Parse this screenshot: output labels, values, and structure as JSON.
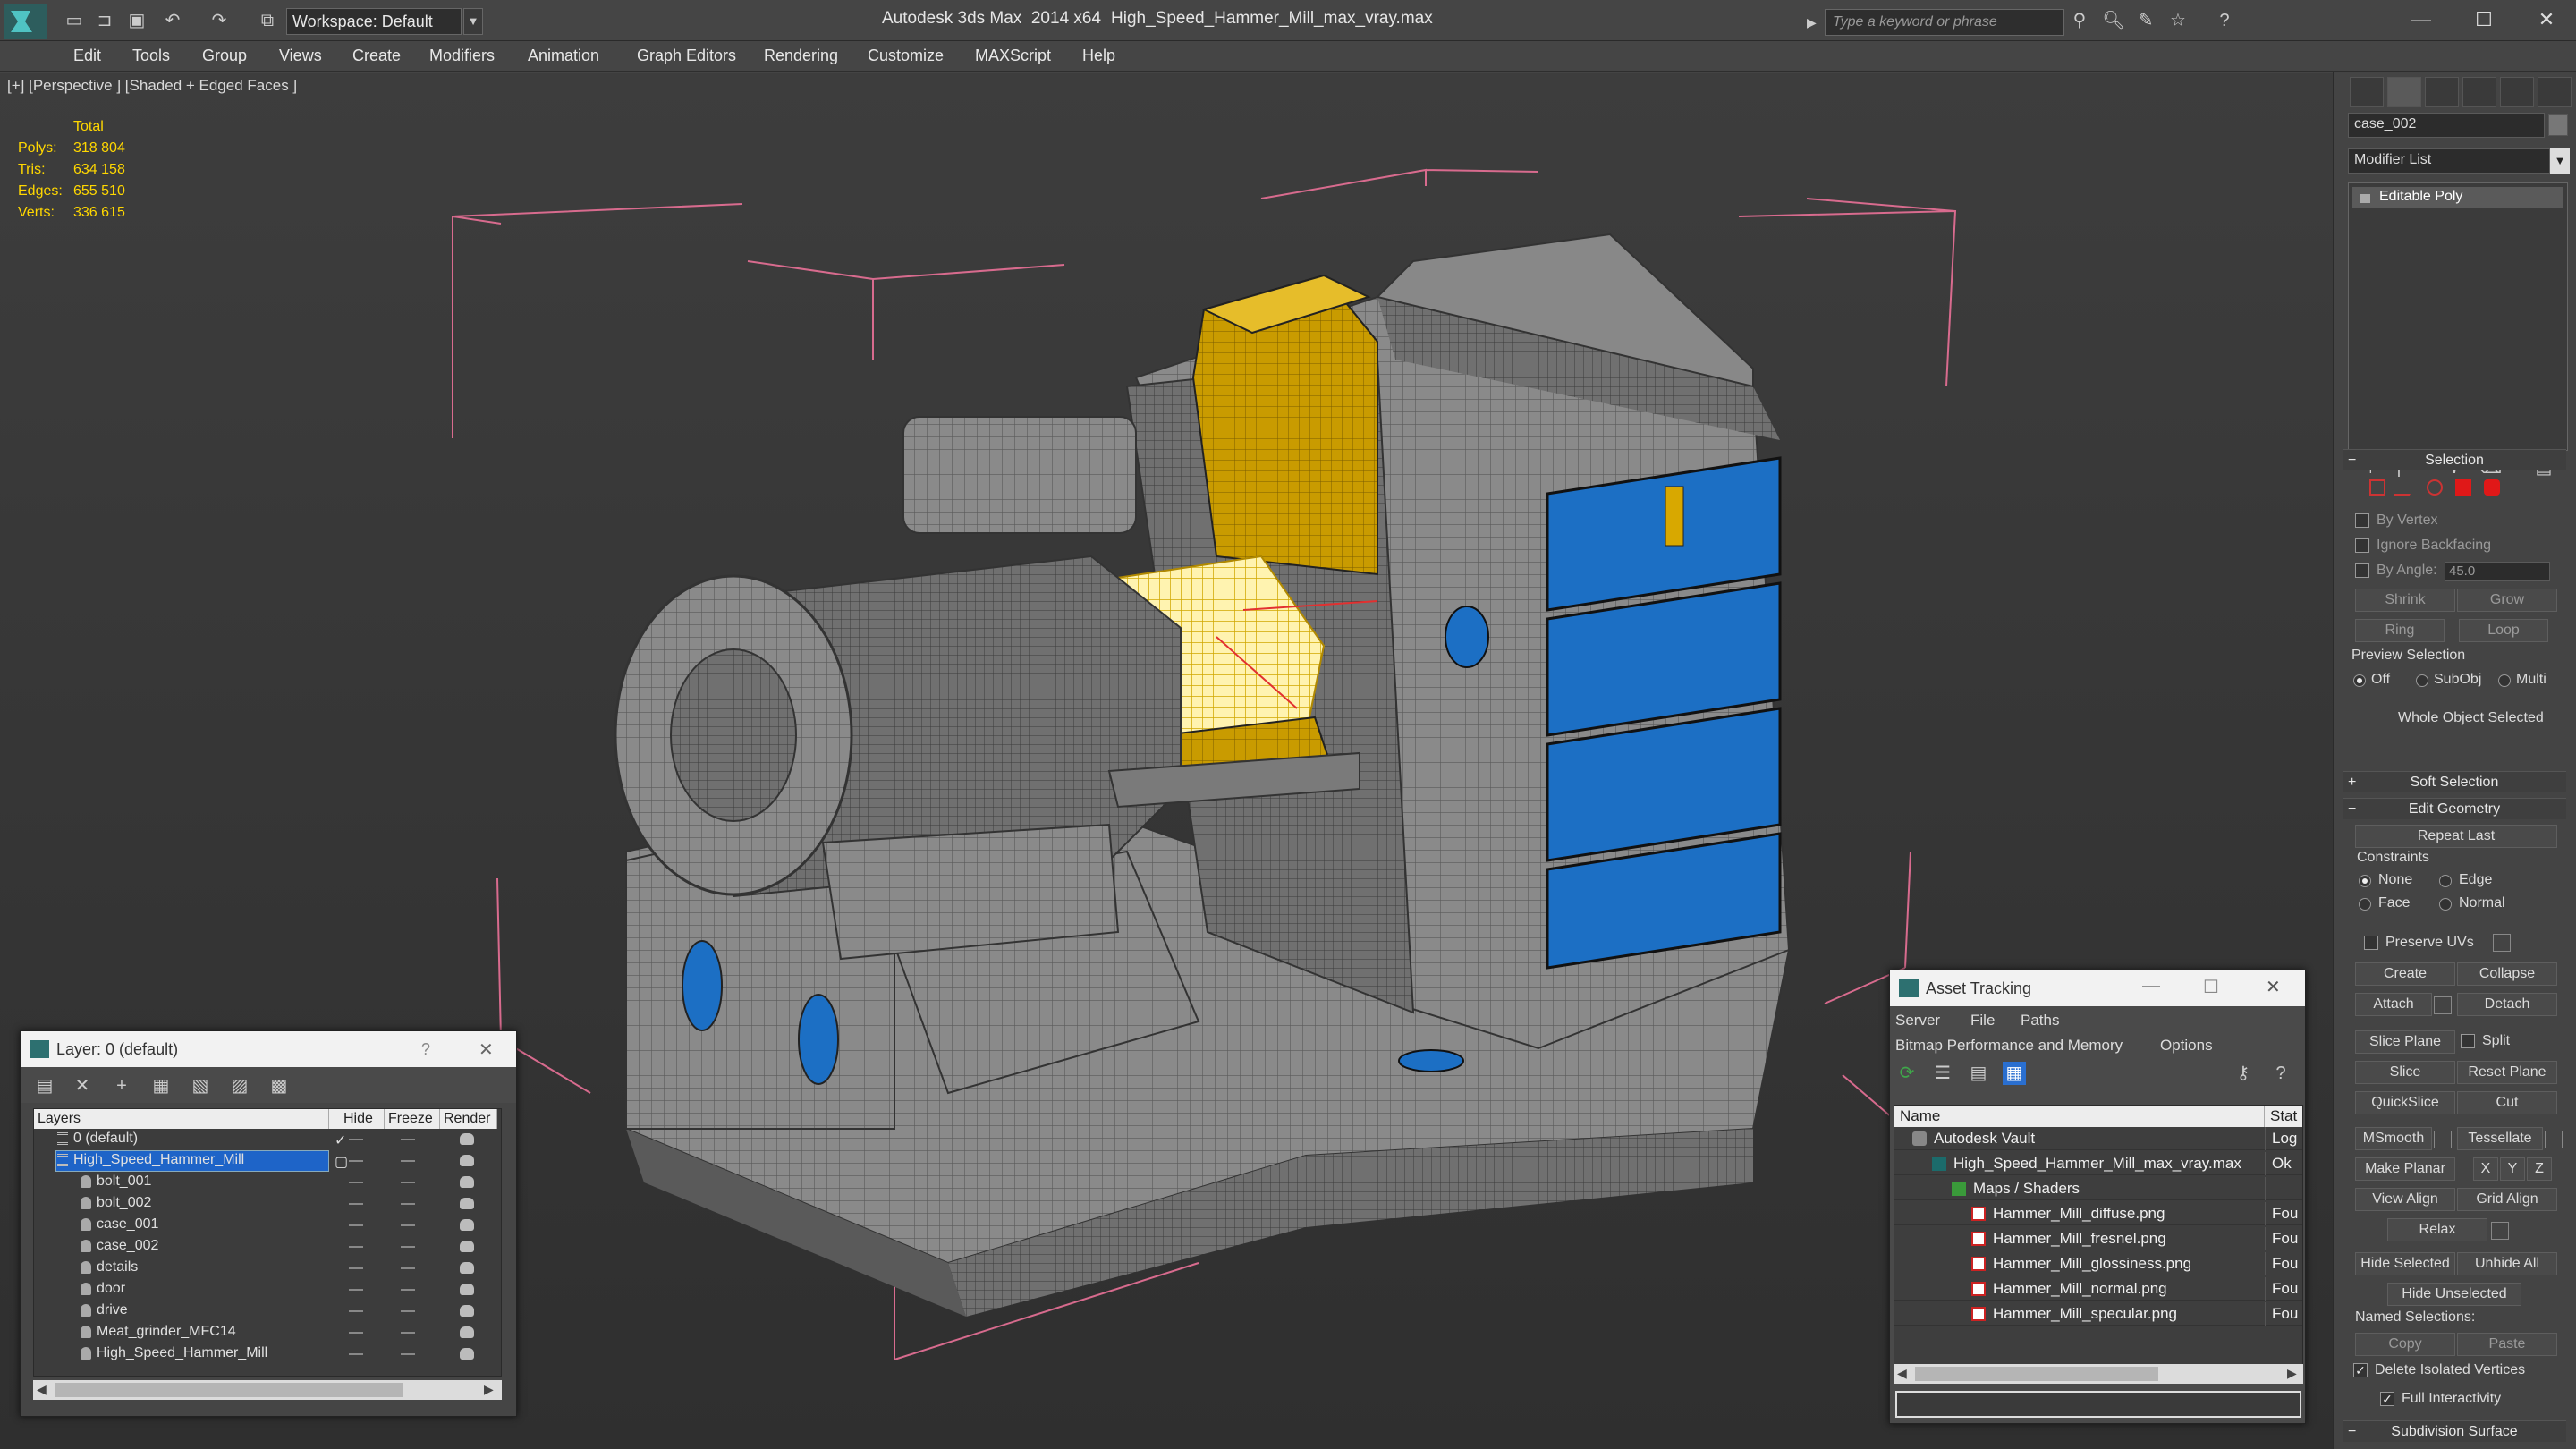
{
  "titlebar": {
    "workspace_label": "Workspace: Default",
    "app_name": "Autodesk 3ds Max  2014 x64",
    "file_name": "High_Speed_Hammer_Mill_max_vray.max",
    "search_placeholder": "Type a keyword or phrase"
  },
  "menu": [
    "Edit",
    "Tools",
    "Group",
    "Views",
    "Create",
    "Modifiers",
    "Animation",
    "Graph Editors",
    "Rendering",
    "Customize",
    "MAXScript",
    "Help"
  ],
  "viewport": {
    "label": "[+] [Perspective ] [Shaded + Edged Faces ]",
    "stats": {
      "header": "Total",
      "rows": [
        {
          "label": "Polys:",
          "value": "318 804"
        },
        {
          "label": "Tris:",
          "value": "634 158"
        },
        {
          "label": "Edges:",
          "value": "655 510"
        },
        {
          "label": "Verts:",
          "value": "336 615"
        }
      ]
    }
  },
  "command_panel": {
    "object_name": "case_002",
    "modifier_list": "Modifier List",
    "stack_item": "Editable Poly",
    "selection": {
      "title": "Selection",
      "by_vertex": "By Vertex",
      "ignore_backfacing": "Ignore Backfacing",
      "by_angle": "By Angle:",
      "angle_value": "45.0",
      "shrink": "Shrink",
      "grow": "Grow",
      "ring": "Ring",
      "loop": "Loop",
      "preview_selection": "Preview Selection",
      "preview_off": "Off",
      "preview_subobj": "SubObj",
      "preview_multi": "Multi",
      "status": "Whole Object Selected"
    },
    "soft_selection": "Soft Selection",
    "edit_geometry": {
      "title": "Edit Geometry",
      "repeat_last": "Repeat Last",
      "constraints": "Constraints",
      "none": "None",
      "edge": "Edge",
      "face": "Face",
      "normal": "Normal",
      "preserve_uvs": "Preserve UVs",
      "create": "Create",
      "collapse": "Collapse",
      "attach": "Attach",
      "detach": "Detach",
      "slice_plane": "Slice Plane",
      "split": "Split",
      "slice": "Slice",
      "reset_plane": "Reset Plane",
      "quickslice": "QuickSlice",
      "cut": "Cut",
      "msmooth": "MSmooth",
      "tessellate": "Tessellate",
      "make_planar": "Make Planar",
      "x": "X",
      "y": "Y",
      "z": "Z",
      "view_align": "View Align",
      "grid_align": "Grid Align",
      "relax": "Relax",
      "hide_selected": "Hide Selected",
      "unhide_all": "Unhide All",
      "hide_unselected": "Hide Unselected",
      "named_selections": "Named Selections:",
      "copy": "Copy",
      "paste": "Paste",
      "delete_isolated": "Delete Isolated Vertices",
      "full_interactivity": "Full Interactivity"
    },
    "subdivision_surface": "Subdivision Surface"
  },
  "layer_window": {
    "title": "Layer: 0 (default)",
    "help": "?",
    "columns": [
      "Layers",
      "Hide",
      "Freeze",
      "Render"
    ],
    "rows": [
      {
        "name": "0 (default)",
        "indent": 1,
        "kind": "layer"
      },
      {
        "name": "High_Speed_Hammer_Mill",
        "indent": 1,
        "kind": "layer",
        "selected": true
      },
      {
        "name": "bolt_001",
        "indent": 2,
        "kind": "object"
      },
      {
        "name": "bolt_002",
        "indent": 2,
        "kind": "object"
      },
      {
        "name": "case_001",
        "indent": 2,
        "kind": "object"
      },
      {
        "name": "case_002",
        "indent": 2,
        "kind": "object"
      },
      {
        "name": "details",
        "indent": 2,
        "kind": "object"
      },
      {
        "name": "door",
        "indent": 2,
        "kind": "object"
      },
      {
        "name": "drive",
        "indent": 2,
        "kind": "object"
      },
      {
        "name": "Meat_grinder_MFC14",
        "indent": 2,
        "kind": "object"
      },
      {
        "name": "High_Speed_Hammer_Mill",
        "indent": 2,
        "kind": "object"
      }
    ]
  },
  "asset_window": {
    "title": "Asset Tracking",
    "menu": [
      "Server",
      "File",
      "Paths",
      "Bitmap Performance and Memory",
      "Options"
    ],
    "columns": [
      "Name",
      "Stat"
    ],
    "rows": [
      {
        "name": "Autodesk Vault",
        "status": "Log",
        "indent": 0,
        "icon": "vault"
      },
      {
        "name": "High_Speed_Hammer_Mill_max_vray.max",
        "status": "Ok",
        "indent": 1,
        "icon": "max"
      },
      {
        "name": "Maps / Shaders",
        "status": "",
        "indent": 2,
        "icon": "maps"
      },
      {
        "name": "Hammer_Mill_diffuse.png",
        "status": "Fou",
        "indent": 3,
        "icon": "png"
      },
      {
        "name": "Hammer_Mill_fresnel.png",
        "status": "Fou",
        "indent": 3,
        "icon": "png"
      },
      {
        "name": "Hammer_Mill_glossiness.png",
        "status": "Fou",
        "indent": 3,
        "icon": "png"
      },
      {
        "name": "Hammer_Mill_normal.png",
        "status": "Fou",
        "indent": 3,
        "icon": "png"
      },
      {
        "name": "Hammer_Mill_specular.png",
        "status": "Fou",
        "indent": 3,
        "icon": "png"
      }
    ]
  },
  "colors": {
    "stats_yellow": "#ffd700",
    "selection_blue": "#1e64c8",
    "bbox_pink": "#d86b8e",
    "mill_blue": "#1c6fc4",
    "mill_yellow": "#d8a800"
  }
}
